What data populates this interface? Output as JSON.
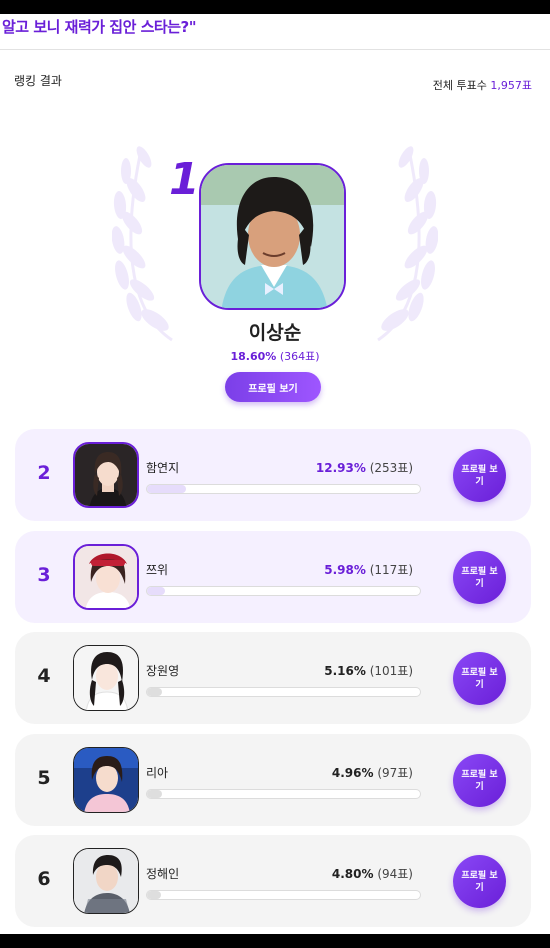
{
  "header": {
    "title": "알고 보니 재력가 집안 스타는?\""
  },
  "results": {
    "label": "랭킹 결과",
    "total_prefix": "전체 투표수",
    "total_count": "1,957표"
  },
  "winner": {
    "rank": "1",
    "name": "이상순",
    "percent": "18.60%",
    "votes": "(364표)",
    "profile_label": "프로필 보기"
  },
  "rankings": [
    {
      "rank": "2",
      "name": "함연지",
      "percent": "12.93%",
      "votes": "(253표)",
      "share": 0.1293,
      "profile_label": "프로필 보기"
    },
    {
      "rank": "3",
      "name": "쯔위",
      "percent": "5.98%",
      "votes": "(117표)",
      "share": 0.0598,
      "profile_label": "프로필 보기"
    },
    {
      "rank": "4",
      "name": "장원영",
      "percent": "5.16%",
      "votes": "(101표)",
      "share": 0.0516,
      "profile_label": "프로필 보기"
    },
    {
      "rank": "5",
      "name": "리아",
      "percent": "4.96%",
      "votes": "(97표)",
      "share": 0.0496,
      "profile_label": "프로필 보기"
    },
    {
      "rank": "6",
      "name": "정해인",
      "percent": "4.80%",
      "votes": "(94표)",
      "share": 0.048,
      "profile_label": "프로필 보기"
    }
  ],
  "colors": {
    "accent": "#6a1fd8",
    "top_card_bg": "#f5f0ff",
    "card_bg": "#f4f4f4"
  },
  "icons": {
    "wreath": "laurel-wreath-icon"
  }
}
